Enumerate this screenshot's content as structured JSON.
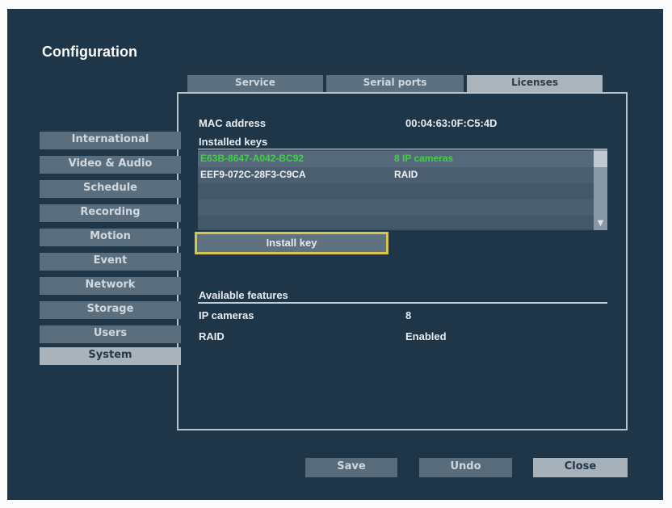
{
  "title": "Configuration",
  "tabs": [
    {
      "label": "Service"
    },
    {
      "label": "Serial ports"
    },
    {
      "label": "Licenses"
    }
  ],
  "sidebar": {
    "items": [
      {
        "label": "International"
      },
      {
        "label": "Video & Audio"
      },
      {
        "label": "Schedule"
      },
      {
        "label": "Recording"
      },
      {
        "label": "Motion"
      },
      {
        "label": "Event"
      },
      {
        "label": "Network"
      },
      {
        "label": "Storage"
      },
      {
        "label": "Users"
      },
      {
        "label": "System"
      }
    ]
  },
  "licenses": {
    "mac_label": "MAC address",
    "mac_value": "00:04:63:0F:C5:4D",
    "installed_keys_label": "Installed keys",
    "keys": [
      {
        "key": "E63B-8647-A042-BC92",
        "feature": "8 IP cameras"
      },
      {
        "key": "EEF9-072C-28F3-C9CA",
        "feature": "RAID"
      }
    ],
    "install_button": "Install key",
    "available_label": "Available features",
    "features": [
      {
        "name": "IP cameras",
        "value": "8"
      },
      {
        "name": "RAID",
        "value": "Enabled"
      }
    ]
  },
  "buttons": {
    "save": "Save",
    "undo": "Undo",
    "close": "Close"
  },
  "colors": {
    "background": "#1f3548",
    "selected_key": "#3fd146",
    "focus_border": "#d6c64a"
  }
}
